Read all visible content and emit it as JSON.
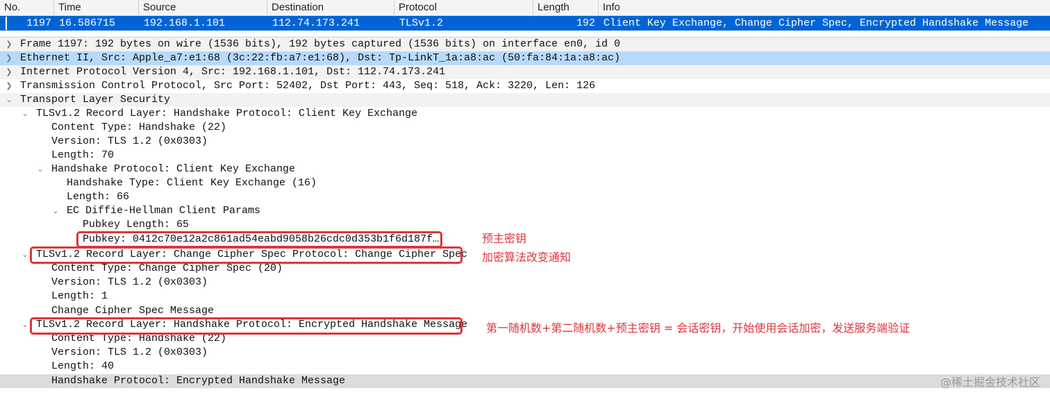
{
  "packet_list": {
    "columns": [
      "No.",
      "Time",
      "Source",
      "Destination",
      "Protocol",
      "Length",
      "Info"
    ],
    "selected_row": {
      "no": "1197",
      "time": "16.586715",
      "source": "192.168.1.101",
      "destination": "112.74.173.241",
      "protocol": "TLSv1.2",
      "length": "192",
      "info": "Client Key Exchange, Change Cipher Spec, Encrypted Handshake Message"
    }
  },
  "details": [
    {
      "text": "Frame 1197: 192 bytes on wire (1536 bits), 192 bytes captured (1536 bits) on interface en0, id 0",
      "arrow": "collapsed"
    },
    {
      "text": "Ethernet II, Src: Apple_a7:e1:68 (3c:22:fb:a7:e1:68), Dst: Tp-LinkT_1a:a8:ac (50:fa:84:1a:a8:ac)",
      "arrow": "collapsed"
    },
    {
      "text": "Internet Protocol Version 4, Src: 192.168.1.101, Dst: 112.74.173.241",
      "arrow": "collapsed"
    },
    {
      "text": "Transmission Control Protocol, Src Port: 52402, Dst Port: 443, Seq: 518, Ack: 3220, Len: 126",
      "arrow": "collapsed"
    },
    {
      "text": "Transport Layer Security",
      "arrow": "expanded"
    },
    {
      "text": "TLSv1.2 Record Layer: Handshake Protocol: Client Key Exchange",
      "arrow": "expanded"
    },
    {
      "text": "Content Type: Handshake (22)",
      "arrow": "none"
    },
    {
      "text": "Version: TLS 1.2 (0x0303)",
      "arrow": "none"
    },
    {
      "text": "Length: 70",
      "arrow": "none"
    },
    {
      "text": "Handshake Protocol: Client Key Exchange",
      "arrow": "expanded"
    },
    {
      "text": "Handshake Type: Client Key Exchange (16)",
      "arrow": "none"
    },
    {
      "text": "Length: 66",
      "arrow": "none"
    },
    {
      "text": "EC Diffie-Hellman Client Params",
      "arrow": "expanded"
    },
    {
      "text": "Pubkey Length: 65",
      "arrow": "none"
    },
    {
      "text": "Pubkey: 0412c70e12a2c861ad54eabd9058b26cdc0d353b1f6d187f…",
      "arrow": "none"
    },
    {
      "text": "TLSv1.2 Record Layer: Change Cipher Spec Protocol: Change Cipher Spec",
      "arrow": "expanded"
    },
    {
      "text": "Content Type: Change Cipher Spec (20)",
      "arrow": "none"
    },
    {
      "text": "Version: TLS 1.2 (0x0303)",
      "arrow": "none"
    },
    {
      "text": "Length: 1",
      "arrow": "none"
    },
    {
      "text": "Change Cipher Spec Message",
      "arrow": "none"
    },
    {
      "text": "TLSv1.2 Record Layer: Handshake Protocol: Encrypted Handshake Message",
      "arrow": "expanded"
    },
    {
      "text": "Content Type: Handshake (22)",
      "arrow": "none"
    },
    {
      "text": "Version: TLS 1.2 (0x0303)",
      "arrow": "none"
    },
    {
      "text": "Length: 40",
      "arrow": "none"
    },
    {
      "text": "Handshake Protocol: Encrypted Handshake Message",
      "arrow": "none"
    }
  ],
  "annotations": {
    "pre_master_key": "预主密钥",
    "cipher_change_notice": "加密算法改变通知",
    "session_key_note": "第一随机数+第二随机数+预主密钥 = 会话密钥，开始使用会话加密，发送服务端验证"
  },
  "watermark": "@稀土掘金技术社区",
  "colors": {
    "selection_blue": "#0064d6",
    "highlight_row": "#b7dafa",
    "annotation_red": "#e0343a"
  }
}
